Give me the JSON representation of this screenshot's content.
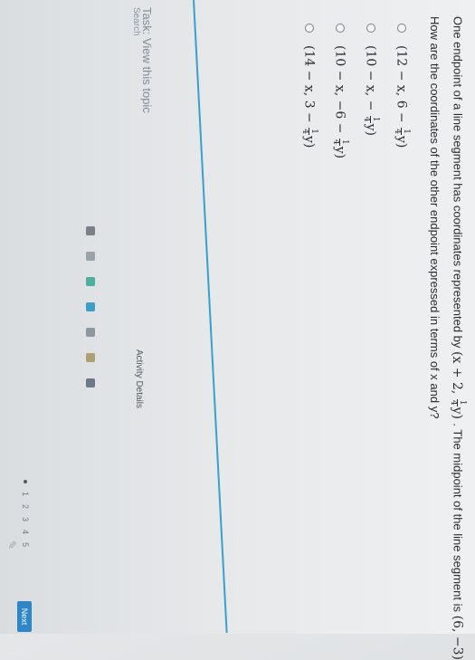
{
  "question": {
    "line1_prefix": "One endpoint of a line segment has coordinates represented by",
    "endpoint_a": "(x + 2, ",
    "endpoint_b": "y)",
    "line1_mid": ". The midpoint of the line segment is",
    "midpoint": "(6, −3)",
    "line2": "How are the coordinates of the other endpoint expressed in terms of x and y?"
  },
  "fraction": {
    "num": "1",
    "den": "4"
  },
  "options": [
    {
      "a": "(12 − x, 6 − ",
      "b": "y)"
    },
    {
      "a": "(10 − x, − ",
      "b": "y)"
    },
    {
      "a": "(10 − x, −6 − ",
      "b": "y)"
    },
    {
      "a": "(14 − x, 3 − ",
      "b": "y)"
    }
  ],
  "footer": {
    "task_link": "Task: View this topic",
    "search_text": "Search",
    "activity_details": "Activity Details",
    "pages": [
      "1",
      "2",
      "3",
      "4",
      "5"
    ],
    "next_label": "Next"
  },
  "accent_color": "#3a9fc9",
  "button_color": "#2d86c8"
}
